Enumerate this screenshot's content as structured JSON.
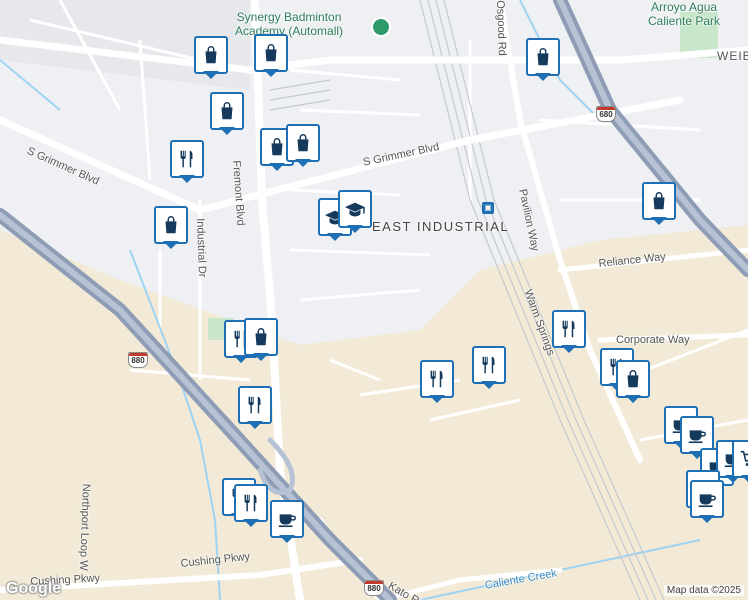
{
  "map": {
    "area_label": "EAST INDUSTRIAL",
    "poi": {
      "name_line1": "Synergy Badminton",
      "name_line2": "Academy (Automall)"
    },
    "park": {
      "line1": "Arroyo Agua",
      "line2": "Caliente Park"
    },
    "roads": {
      "s_grimmer_left": "S Grimmer Blvd",
      "s_grimmer_right": "S Grimmer Blvd",
      "fremont": "Fremont Blvd",
      "industrial": "Industrial Dr",
      "osgood": "Osgood Rd",
      "pavilion": "Pavilion Way",
      "reliance": "Reliance Way",
      "warm_springs": "Warm Springs",
      "corporate": "Corporate Way",
      "cushing": "Cushing Pkwy",
      "northport": "Northport Loop W",
      "cushing_left": "Cushing Pkwy",
      "kato": "Kato Rd",
      "caliente_creek": "Caliente Creek",
      "weibel": "WEIB"
    },
    "shields": {
      "i880_a": "880",
      "i880_b": "880",
      "i680": "680"
    },
    "transit_icon": "train-station-icon",
    "colors": {
      "pin_border": "#1f6fb4",
      "park": "#c8e6c9",
      "industrial": "#f2ead6",
      "highway": "#8e9db5"
    }
  },
  "markers": [
    {
      "type": "shopping-bag-icon"
    },
    {
      "type": "shopping-bag-icon"
    },
    {
      "type": "shopping-bag-icon"
    },
    {
      "type": "shopping-bag-icon"
    },
    {
      "type": "shopping-bag-icon"
    },
    {
      "type": "shopping-bag-icon"
    },
    {
      "type": "restaurant-icon"
    },
    {
      "type": "shopping-bag-icon"
    },
    {
      "type": "graduation-cap-icon"
    },
    {
      "type": "graduation-cap-icon"
    },
    {
      "type": "shopping-bag-icon"
    },
    {
      "type": "restaurant-icon"
    },
    {
      "type": "shopping-bag-icon"
    },
    {
      "type": "restaurant-icon"
    },
    {
      "type": "restaurant-icon"
    },
    {
      "type": "restaurant-icon"
    },
    {
      "type": "restaurant-icon"
    },
    {
      "type": "shopping-bag-icon"
    },
    {
      "type": "restaurant-icon"
    },
    {
      "type": "restaurant-icon"
    },
    {
      "type": "restaurant-icon"
    },
    {
      "type": "coffee-icon"
    },
    {
      "type": "coffee-icon"
    },
    {
      "type": "coffee-icon"
    },
    {
      "type": "coffee-icon"
    },
    {
      "type": "coffee-icon"
    },
    {
      "type": "coffee-icon"
    },
    {
      "type": "shopping-cart-icon"
    },
    {
      "type": "coffee-icon"
    }
  ],
  "attribution": {
    "logo": "Google",
    "text": "Map data ©2025"
  }
}
